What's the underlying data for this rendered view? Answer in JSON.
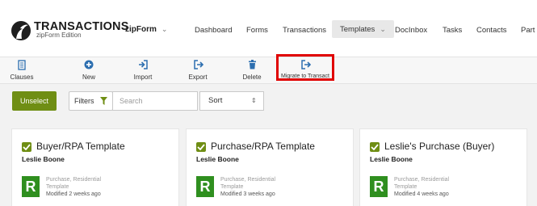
{
  "logo": {
    "title": "TRANSACTIONS",
    "subtitle": "zipForm Edition"
  },
  "product_switcher": {
    "label": "zipForm"
  },
  "nav": {
    "items": [
      {
        "label": "Dashboard"
      },
      {
        "label": "Forms"
      },
      {
        "label": "Transactions"
      },
      {
        "label": "Templates",
        "active": true
      },
      {
        "label": "DocInbox"
      },
      {
        "label": "Tasks"
      },
      {
        "label": "Contacts"
      },
      {
        "label": "Part"
      }
    ]
  },
  "toolbar": {
    "items": [
      {
        "label": "Clauses",
        "icon": "clauses-icon"
      },
      {
        "label": "New",
        "icon": "plus-circle-icon"
      },
      {
        "label": "Import",
        "icon": "import-icon"
      },
      {
        "label": "Export",
        "icon": "export-icon"
      },
      {
        "label": "Delete",
        "icon": "trash-icon"
      },
      {
        "label": "Migrate to Transact",
        "icon": "migrate-icon",
        "highlighted": true
      }
    ]
  },
  "filters": {
    "unselect_label": "Unselect",
    "filters_label": "Filters",
    "search_placeholder": "Search",
    "sort_label": "Sort"
  },
  "cards": [
    {
      "title": "Buyer/RPA Template",
      "owner": "Leslie Boone",
      "badge": "R",
      "type": "Purchase, Residential",
      "kind": "Template",
      "modified": "Modified 2 weeks ago",
      "checked": true
    },
    {
      "title": "Purchase/RPA Template",
      "owner": "Leslie Boone",
      "badge": "R",
      "type": "Purchase, Residential",
      "kind": "Template",
      "modified": "Modified 3 weeks ago",
      "checked": true
    },
    {
      "title": "Leslie's Purchase (Buyer)",
      "owner": "Leslie Boone",
      "badge": "R",
      "type": "Purchase, Residential",
      "kind": "Template",
      "modified": "Modified 4 weeks ago",
      "checked": true
    }
  ],
  "colors": {
    "brand_green": "#6f8e14",
    "card_badge_green": "#2f8f1f",
    "icon_blue": "#2d6fb0",
    "highlight_red": "#e00000"
  }
}
